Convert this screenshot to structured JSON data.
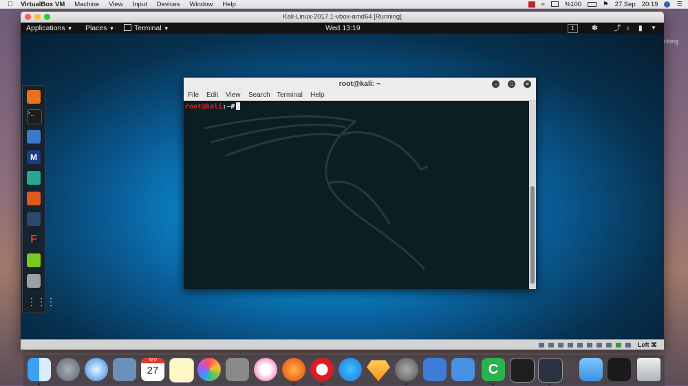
{
  "mac_menubar": {
    "app_name": "VirtualBox VM",
    "menus": [
      "Machine",
      "View",
      "Input",
      "Devices",
      "Window",
      "Help"
    ],
    "battery": "%100",
    "date": "27 Sep",
    "time": "20:19"
  },
  "vm_window": {
    "title": "Kali-Linux-2017.1-vbox-amd64 [Running]",
    "host_key_label": "Left ⌘"
  },
  "gnome_bar": {
    "applications": "Applications",
    "places": "Places",
    "terminal": "Terminal",
    "clock": "Wed 13:19",
    "workspace": "1"
  },
  "terminal": {
    "title": "root@kali: ~",
    "menu": [
      "File",
      "Edit",
      "View",
      "Search",
      "Terminal",
      "Help"
    ],
    "prompt_user": "root@kali",
    "prompt_path": ":~#"
  },
  "background_window": {
    "text_fragment": "cking"
  },
  "calendar_icon": {
    "month": "SEP",
    "day": "27"
  },
  "colors": {
    "desktop_glow": "#33c6ff",
    "terminal_bg": "#0b1e24",
    "prompt_red": "#e02020"
  }
}
